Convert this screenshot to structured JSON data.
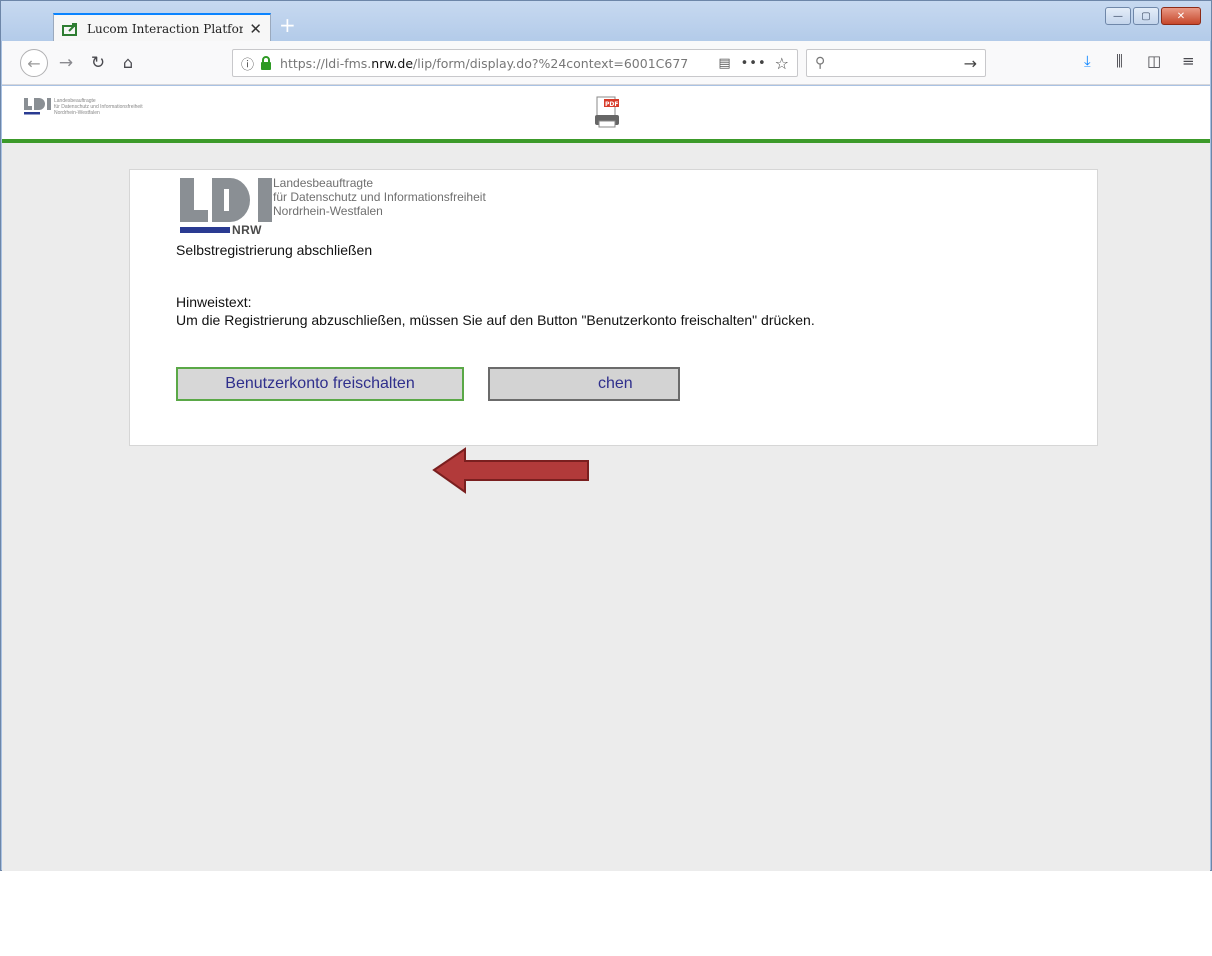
{
  "browser": {
    "tab_title": "Lucom Interaction Platform (Se",
    "tab_close": "✕",
    "new_tab": "+",
    "url_host_prefix": "https://ldi-fms.",
    "url_host": "nrw.de",
    "url_path": "/lip/form/display.do?%24context=6001C677",
    "url_dots": "•••",
    "window_controls": {
      "minimize": "—",
      "maximize": "▢",
      "close": "✕"
    },
    "colors": {
      "tab_accent": "#0a84ff",
      "lock": "#2e9a24"
    }
  },
  "site_header": {
    "small_logo_lines": [
      "Landesbeauftragte",
      "für Datenschutz und Informationsfreiheit",
      "Nordrhein-Westfalen"
    ],
    "pdf_icon": "pdf-print-icon",
    "accent_color": "#3c9a2a"
  },
  "logo": {
    "lines": [
      "Landesbeauftragte",
      "für Datenschutz und Informationsfreiheit",
      "Nordrhein-Westfalen"
    ],
    "nrw": "NRW",
    "colors": {
      "letters": "#8a8f94",
      "nrw_bar": "#2a3b92"
    }
  },
  "form": {
    "title": "Selbstregistrierung abschließen",
    "hint_label": "Hinweistext:",
    "hint_text": "Um die Registrierung abzuschließen, müssen Sie auf den Button \"Benutzerkonto freischalten\" drücken.",
    "primary_button": "Benutzerkonto freischalten",
    "secondary_button_visible": "chen"
  },
  "annotation": {
    "arrow_color": "#b23a3a",
    "arrow_icon": "red-arrow-left-icon"
  }
}
